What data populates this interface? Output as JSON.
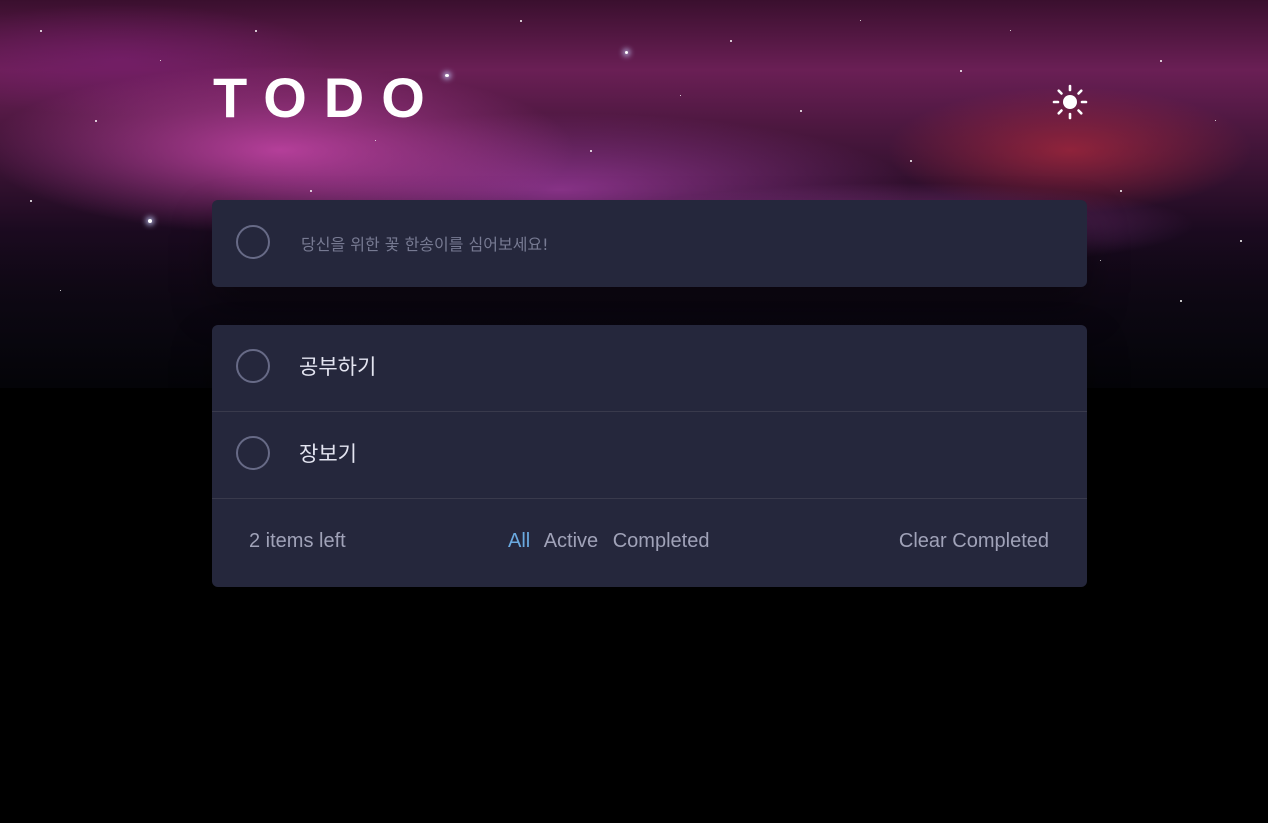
{
  "app": {
    "title": "TODO",
    "theme_icon": "sun-icon"
  },
  "new_todo": {
    "placeholder": "당신을 위한 꽃 한송이를 심어보세요!",
    "value": ""
  },
  "todos": [
    {
      "text": "공부하기",
      "completed": false
    },
    {
      "text": "장보기",
      "completed": false
    }
  ],
  "footer": {
    "items_left": "2 items left",
    "filters": [
      "All",
      "Active",
      "Completed"
    ],
    "active_filter": "All",
    "clear_label": "Clear Completed"
  },
  "colors": {
    "card": "#25273c",
    "accent": "#6aa9e0",
    "muted_text": "#a0a2b8",
    "text": "#e4e5f1",
    "background": "#000000"
  }
}
